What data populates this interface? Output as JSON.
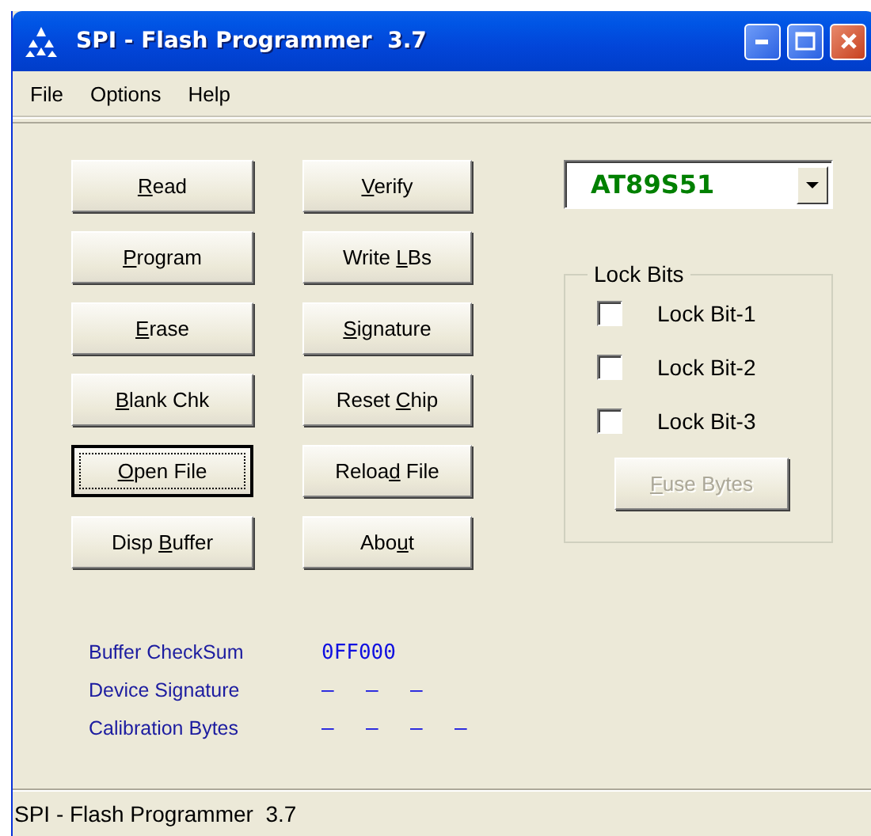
{
  "window": {
    "title": "SPI - Flash Programmer  3.7"
  },
  "menu": [
    "File",
    "Options",
    "Help"
  ],
  "buttons_left": [
    {
      "key": "R",
      "post": "ead",
      "focused": false
    },
    {
      "key": "P",
      "post": "rogram",
      "focused": false
    },
    {
      "key": "E",
      "post": "rase",
      "focused": false
    },
    {
      "key": "B",
      "post": "lank Chk",
      "focused": false
    },
    {
      "key": "O",
      "post": "pen File",
      "focused": true
    },
    {
      "pre": "Disp ",
      "key": "B",
      "post": "uffer",
      "focused": false
    }
  ],
  "buttons_right": [
    {
      "key": "V",
      "post": "erify",
      "focused": false
    },
    {
      "pre": "Write ",
      "key": "L",
      "post": "Bs",
      "focused": false
    },
    {
      "key": "S",
      "post": "ignature",
      "focused": false
    },
    {
      "pre": "Reset ",
      "key": "C",
      "post": "hip",
      "focused": false
    },
    {
      "pre": "Reloa",
      "key": "d",
      "post": " File",
      "focused": false
    },
    {
      "pre": "Abo",
      "key": "u",
      "post": "t",
      "focused": false
    }
  ],
  "device": {
    "value": "AT89S51"
  },
  "lock_bits": {
    "title": "Lock Bits",
    "items": [
      {
        "label": "Lock Bit-1",
        "checked": false
      },
      {
        "label": "Lock Bit-2",
        "checked": false
      },
      {
        "label": "Lock Bit-3",
        "checked": false
      }
    ],
    "fuse_button": {
      "key": "F",
      "post": "use Bytes",
      "disabled": true
    }
  },
  "info": [
    {
      "label": "Buffer CheckSum",
      "values": [
        "0FF000"
      ]
    },
    {
      "label": "Device Signature",
      "values": [
        "–",
        "–",
        "–"
      ]
    },
    {
      "label": "Calibration Bytes",
      "values": [
        "–",
        "–",
        "–",
        "–"
      ]
    }
  ],
  "status_bar": "SPI - Flash Programmer  3.7"
}
